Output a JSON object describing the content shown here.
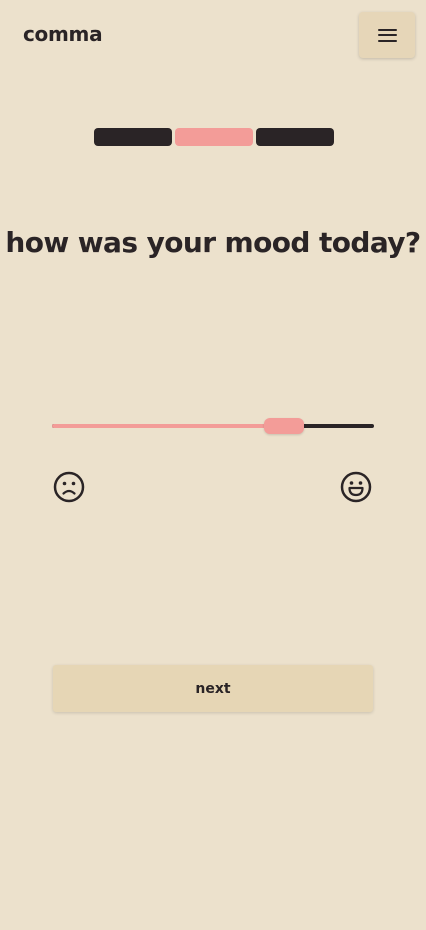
{
  "app": {
    "title": "comma"
  },
  "header": {
    "menu_icon": "hamburger-menu-icon"
  },
  "progress": {
    "total_steps": 3,
    "current_step": 2
  },
  "question": {
    "text": "how was your mood today?"
  },
  "mood_slider": {
    "value": 0.72,
    "min_icon": "sad-face-icon",
    "max_icon": "happy-face-icon"
  },
  "actions": {
    "next_label": "next"
  },
  "colors": {
    "background": "#ece1cc",
    "accent": "#f39c98",
    "dark": "#2a2426",
    "button": "#e6d6b5"
  }
}
